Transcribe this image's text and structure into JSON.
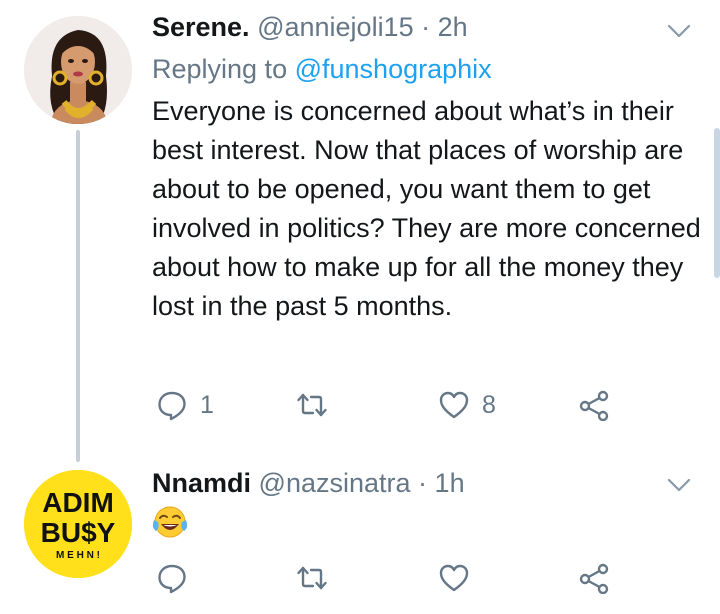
{
  "tweets": [
    {
      "display_name": "Serene.",
      "handle": "@anniejoli15",
      "separator": "·",
      "time": "2h",
      "reply_prefix": "Replying to",
      "reply_handle": "@funshographix",
      "text": "Everyone is concerned about what’s in their best interest. Now that places of worship are about to be opened, you want them to get involved in politics? They are more concerned about how to make up for all the money they lost in the past 5 months.",
      "reply_count": "1",
      "retweet_count": "",
      "like_count": "8"
    },
    {
      "display_name": "Nnamdi",
      "handle": "@nazsinatra",
      "separator": "·",
      "time": "1h",
      "avatar_text_line1": "ADIM",
      "avatar_text_line2": "BU$Y",
      "avatar_text_line3": "M E H N !",
      "emoji": "face-with-tears-of-joy",
      "reply_count": "",
      "retweet_count": "",
      "like_count": ""
    }
  ],
  "colors": {
    "accent": "#1da1f2",
    "secondary_text": "#657786",
    "thread_line": "#c4cfd6"
  }
}
